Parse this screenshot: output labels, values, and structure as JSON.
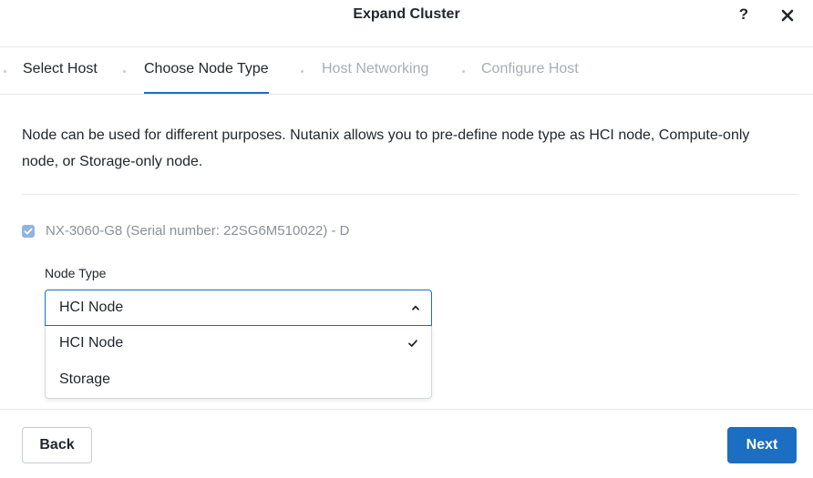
{
  "dialog": {
    "title": "Expand Cluster",
    "help_label": "?"
  },
  "steps": [
    {
      "label": "Select Host",
      "state": "done"
    },
    {
      "label": "Choose Node Type",
      "state": "active"
    },
    {
      "label": "Host Networking",
      "state": "todo"
    },
    {
      "label": "Configure Host",
      "state": "todo"
    }
  ],
  "content": {
    "description": "Node can be used for different purposes. Nutanix allows you to pre-define node type as HCI node, Compute-only node, or Storage-only node.",
    "node": {
      "checked": true,
      "label": "NX-3060-G8 (Serial number: 22SG6M510022) - D"
    },
    "node_type": {
      "label": "Node Type",
      "selected": "HCI Node",
      "options": [
        {
          "label": "HCI Node",
          "selected": true
        },
        {
          "label": "Storage",
          "selected": false
        }
      ]
    }
  },
  "footer": {
    "back_label": "Back",
    "next_label": "Next"
  },
  "colors": {
    "accent": "#1b6ec2",
    "checkbox_disabled": "#8fb4de",
    "muted_text": "#a7adb5"
  },
  "icons": [
    "close-icon",
    "chevron-up-icon",
    "checkmark-icon",
    "checkbox-checked-icon"
  ]
}
